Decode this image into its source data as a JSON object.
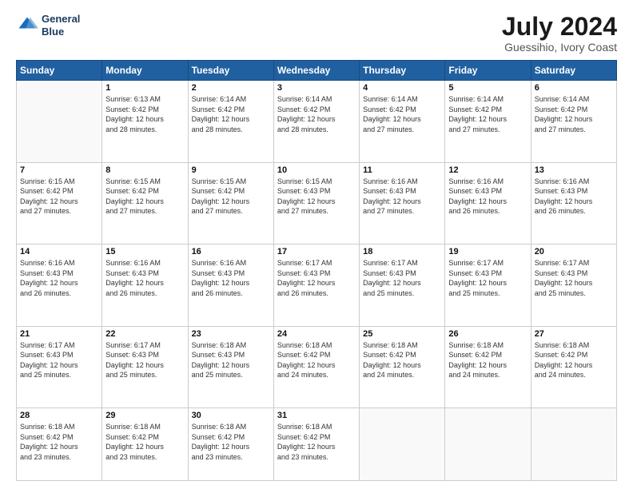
{
  "header": {
    "logo_line1": "General",
    "logo_line2": "Blue",
    "month_year": "July 2024",
    "location": "Guessihio, Ivory Coast"
  },
  "days_of_week": [
    "Sunday",
    "Monday",
    "Tuesday",
    "Wednesday",
    "Thursday",
    "Friday",
    "Saturday"
  ],
  "weeks": [
    [
      {
        "day": "",
        "info": ""
      },
      {
        "day": "1",
        "info": "Sunrise: 6:13 AM\nSunset: 6:42 PM\nDaylight: 12 hours\nand 28 minutes."
      },
      {
        "day": "2",
        "info": "Sunrise: 6:14 AM\nSunset: 6:42 PM\nDaylight: 12 hours\nand 28 minutes."
      },
      {
        "day": "3",
        "info": "Sunrise: 6:14 AM\nSunset: 6:42 PM\nDaylight: 12 hours\nand 28 minutes."
      },
      {
        "day": "4",
        "info": "Sunrise: 6:14 AM\nSunset: 6:42 PM\nDaylight: 12 hours\nand 27 minutes."
      },
      {
        "day": "5",
        "info": "Sunrise: 6:14 AM\nSunset: 6:42 PM\nDaylight: 12 hours\nand 27 minutes."
      },
      {
        "day": "6",
        "info": "Sunrise: 6:14 AM\nSunset: 6:42 PM\nDaylight: 12 hours\nand 27 minutes."
      }
    ],
    [
      {
        "day": "7",
        "info": "Sunrise: 6:15 AM\nSunset: 6:42 PM\nDaylight: 12 hours\nand 27 minutes."
      },
      {
        "day": "8",
        "info": "Sunrise: 6:15 AM\nSunset: 6:42 PM\nDaylight: 12 hours\nand 27 minutes."
      },
      {
        "day": "9",
        "info": "Sunrise: 6:15 AM\nSunset: 6:42 PM\nDaylight: 12 hours\nand 27 minutes."
      },
      {
        "day": "10",
        "info": "Sunrise: 6:15 AM\nSunset: 6:43 PM\nDaylight: 12 hours\nand 27 minutes."
      },
      {
        "day": "11",
        "info": "Sunrise: 6:16 AM\nSunset: 6:43 PM\nDaylight: 12 hours\nand 27 minutes."
      },
      {
        "day": "12",
        "info": "Sunrise: 6:16 AM\nSunset: 6:43 PM\nDaylight: 12 hours\nand 26 minutes."
      },
      {
        "day": "13",
        "info": "Sunrise: 6:16 AM\nSunset: 6:43 PM\nDaylight: 12 hours\nand 26 minutes."
      }
    ],
    [
      {
        "day": "14",
        "info": "Sunrise: 6:16 AM\nSunset: 6:43 PM\nDaylight: 12 hours\nand 26 minutes."
      },
      {
        "day": "15",
        "info": "Sunrise: 6:16 AM\nSunset: 6:43 PM\nDaylight: 12 hours\nand 26 minutes."
      },
      {
        "day": "16",
        "info": "Sunrise: 6:16 AM\nSunset: 6:43 PM\nDaylight: 12 hours\nand 26 minutes."
      },
      {
        "day": "17",
        "info": "Sunrise: 6:17 AM\nSunset: 6:43 PM\nDaylight: 12 hours\nand 26 minutes."
      },
      {
        "day": "18",
        "info": "Sunrise: 6:17 AM\nSunset: 6:43 PM\nDaylight: 12 hours\nand 25 minutes."
      },
      {
        "day": "19",
        "info": "Sunrise: 6:17 AM\nSunset: 6:43 PM\nDaylight: 12 hours\nand 25 minutes."
      },
      {
        "day": "20",
        "info": "Sunrise: 6:17 AM\nSunset: 6:43 PM\nDaylight: 12 hours\nand 25 minutes."
      }
    ],
    [
      {
        "day": "21",
        "info": "Sunrise: 6:17 AM\nSunset: 6:43 PM\nDaylight: 12 hours\nand 25 minutes."
      },
      {
        "day": "22",
        "info": "Sunrise: 6:17 AM\nSunset: 6:43 PM\nDaylight: 12 hours\nand 25 minutes."
      },
      {
        "day": "23",
        "info": "Sunrise: 6:18 AM\nSunset: 6:43 PM\nDaylight: 12 hours\nand 25 minutes."
      },
      {
        "day": "24",
        "info": "Sunrise: 6:18 AM\nSunset: 6:42 PM\nDaylight: 12 hours\nand 24 minutes."
      },
      {
        "day": "25",
        "info": "Sunrise: 6:18 AM\nSunset: 6:42 PM\nDaylight: 12 hours\nand 24 minutes."
      },
      {
        "day": "26",
        "info": "Sunrise: 6:18 AM\nSunset: 6:42 PM\nDaylight: 12 hours\nand 24 minutes."
      },
      {
        "day": "27",
        "info": "Sunrise: 6:18 AM\nSunset: 6:42 PM\nDaylight: 12 hours\nand 24 minutes."
      }
    ],
    [
      {
        "day": "28",
        "info": "Sunrise: 6:18 AM\nSunset: 6:42 PM\nDaylight: 12 hours\nand 23 minutes."
      },
      {
        "day": "29",
        "info": "Sunrise: 6:18 AM\nSunset: 6:42 PM\nDaylight: 12 hours\nand 23 minutes."
      },
      {
        "day": "30",
        "info": "Sunrise: 6:18 AM\nSunset: 6:42 PM\nDaylight: 12 hours\nand 23 minutes."
      },
      {
        "day": "31",
        "info": "Sunrise: 6:18 AM\nSunset: 6:42 PM\nDaylight: 12 hours\nand 23 minutes."
      },
      {
        "day": "",
        "info": ""
      },
      {
        "day": "",
        "info": ""
      },
      {
        "day": "",
        "info": ""
      }
    ]
  ]
}
